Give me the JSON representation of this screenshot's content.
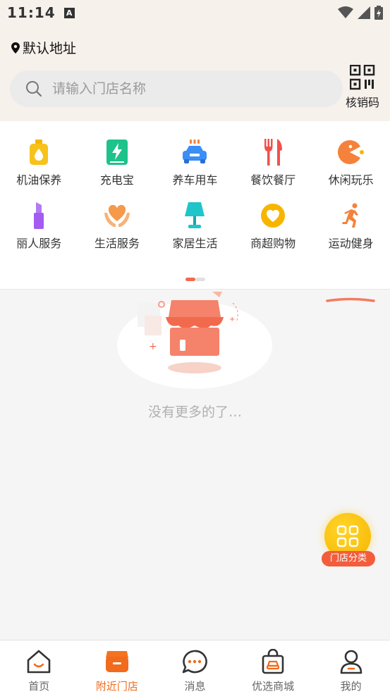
{
  "status_bar": {
    "time": "11:14",
    "notification_badge": "A"
  },
  "header": {
    "location": "默认地址",
    "search": {
      "placeholder": "请输入门店名称",
      "value": ""
    },
    "verify_label": "核销码"
  },
  "categories": [
    {
      "label": "机油保养",
      "icon": "oil-bottle-icon",
      "color": "#f7b500"
    },
    {
      "label": "充电宝",
      "icon": "battery-icon",
      "color": "#1ec28b"
    },
    {
      "label": "养车用车",
      "icon": "car-icon",
      "color": "#3a8ef6"
    },
    {
      "label": "餐饮餐厅",
      "icon": "fork-knife-icon",
      "color": "#f2504c"
    },
    {
      "label": "休闲玩乐",
      "icon": "pacman-icon",
      "color": "#f5823a"
    },
    {
      "label": "丽人服务",
      "icon": "lipstick-icon",
      "color": "#a35cf0"
    },
    {
      "label": "生活服务",
      "icon": "heart-hands-icon",
      "color": "#f59a4a"
    },
    {
      "label": "家居生活",
      "icon": "lamp-icon",
      "color": "#1fc5c9"
    },
    {
      "label": "商超购物",
      "icon": "heart-badge-icon",
      "color": "#f7b500"
    },
    {
      "label": "运动健身",
      "icon": "runner-icon",
      "color": "#f5823a"
    }
  ],
  "pager": {
    "current": 1,
    "total": 2
  },
  "empty_state": {
    "message": "没有更多的了…"
  },
  "float_button": {
    "label": "门店分类"
  },
  "tabs": [
    {
      "label": "首页",
      "icon": "home-icon",
      "active": false
    },
    {
      "label": "附近门店",
      "icon": "store-icon",
      "active": true
    },
    {
      "label": "消息",
      "icon": "message-icon",
      "active": false
    },
    {
      "label": "优选商城",
      "icon": "shopping-bag-icon",
      "active": false
    },
    {
      "label": "我的",
      "icon": "user-icon",
      "active": false
    }
  ],
  "colors": {
    "accent": "#f26a1b",
    "highlight": "#f35d3c"
  }
}
